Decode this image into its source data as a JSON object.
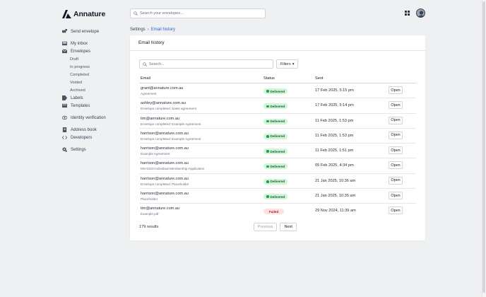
{
  "brand": {
    "name": "Annature"
  },
  "search": {
    "placeholder": "Search your envelopes..."
  },
  "sidebar": {
    "send_envelope": "Send envelope",
    "my_inbox": "My inbox",
    "envelopes": "Envelopes",
    "envelope_sub": [
      "Draft",
      "In progress",
      "Completed",
      "Voided",
      "Archived"
    ],
    "labels": "Labels",
    "templates": "Templates",
    "identity_verification": "Identity verification",
    "address_book": "Address book",
    "developers": "Developers",
    "settings": "Settings"
  },
  "breadcrumb": {
    "parent": "Settings",
    "separator": "›",
    "current": "Email history"
  },
  "card": {
    "title": "Email history",
    "search_placeholder": "Search...",
    "filters_label": "Filters",
    "filters_caret": "▾"
  },
  "table": {
    "columns": {
      "email": "Email",
      "status": "Status",
      "sent": "Sent"
    },
    "open_label": "Open",
    "rows": [
      {
        "email": "grant@annature.com.au",
        "subject": "Agreement",
        "status": "Delivered",
        "sent": "17 Feb 2025, 5:15 pm"
      },
      {
        "email": "ashley@annature.com.au",
        "subject": "Envelope completed: Sales agreement",
        "status": "Delivered",
        "sent": "17 Feb 2025, 5:14 pm"
      },
      {
        "email": "tim@annature.com.au",
        "subject": "Envelope completed: Example Agreement",
        "status": "Delivered",
        "sent": "11 Feb 2025, 1:53 pm"
      },
      {
        "email": "harrison@annature.com.au",
        "subject": "Envelope completed: Example Agreement",
        "status": "Delivered",
        "sent": "11 Feb 2025, 1:53 pm"
      },
      {
        "email": "harrison@annature.com.au",
        "subject": "Example Agreement",
        "status": "Delivered",
        "sent": "11 Feb 2025, 1:51 pm"
      },
      {
        "email": "harrison@annature.com.au",
        "subject": "MS-5323-Individual-Membership-Application",
        "status": "Delivered",
        "sent": "05 Feb 2025, 4:34 pm"
      },
      {
        "email": "harrison@annature.com.au",
        "subject": "Envelope completed: Placeholder",
        "status": "Delivered",
        "sent": "21 Jan 2025, 10:36 am"
      },
      {
        "email": "harrison@annature.com.au",
        "subject": "Placeholder",
        "status": "Delivered",
        "sent": "21 Jan 2025, 10:35 am"
      },
      {
        "email": "tim@annature.com.au",
        "subject": "Example.pdf",
        "status": "Failed",
        "sent": "29 Nov 2024, 11:39 am"
      }
    ]
  },
  "footer": {
    "results": "179 results",
    "previous": "Previous",
    "next": "Next"
  },
  "colors": {
    "accent": "#2563eb",
    "delivered_bg": "#d1f3d8",
    "delivered_fg": "#166534",
    "failed_bg": "#fde2e2",
    "failed_fg": "#b91c1c"
  }
}
